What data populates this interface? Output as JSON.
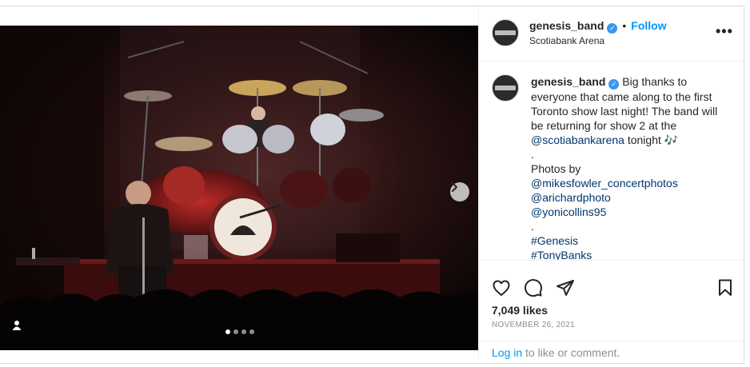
{
  "post": {
    "username": "genesis_band",
    "location": "Scotiabank Arena",
    "follow_label": "Follow",
    "separator": "•",
    "more_label": "•••"
  },
  "caption": {
    "username": "genesis_band",
    "text_1": "Big thanks to everyone that came along to the first Toronto show last night! The band will be returning for show 2 at the",
    "mention_arena": "@scotiabankarena",
    "text_2": "tonight 🎶",
    "dot_1": ".",
    "photos_by": "Photos by",
    "mention_1": "@mikesfowler_concertphotos",
    "mention_2": "@arichardphoto",
    "mention_3": "@yonicollins95",
    "dot_2": ".",
    "hashtag_1": "#Genesis",
    "hashtag_2": "#TonyBanks"
  },
  "stats": {
    "likes": "7,049 likes",
    "date": "NOVEMBER 26, 2021"
  },
  "login": {
    "link_label": "Log in",
    "rest": " to like or comment."
  },
  "carousel": {
    "slides_count": 4,
    "active_index": 0
  },
  "colors": {
    "accent": "#0095f6",
    "verified": "#3897f0",
    "stage_red": "#b3261e"
  }
}
